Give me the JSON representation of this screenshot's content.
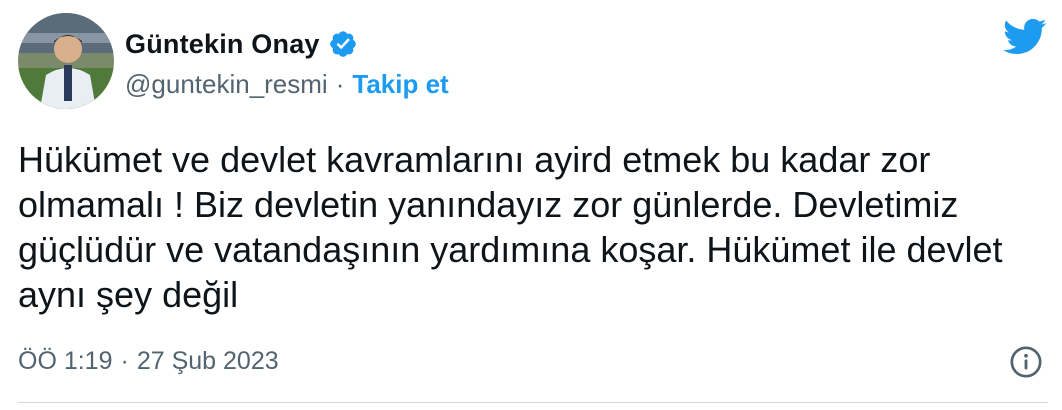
{
  "author": {
    "display_name": "Güntekin Onay",
    "handle": "@guntekin_resmi",
    "separator": "·",
    "follow_label": "Takip et",
    "verified": true
  },
  "tweet": {
    "text": "Hükümet ve devlet kavramlarını ayird etmek bu kadar zor olmamalı ! Biz devletin yanındayız zor günlerde. Devletimiz güçlüdür ve vatandaşının yardımına koşar. Hükümet ile devlet aynı şey değil",
    "time": "ÖÖ 1:19",
    "separator": "·",
    "date": "27 Şub 2023"
  },
  "icons": {
    "brand": "twitter-bird-icon",
    "verified": "verified-badge-icon",
    "info": "info-icon"
  },
  "colors": {
    "accent": "#1d9bf0",
    "text": "#0f1419",
    "secondary": "#536471",
    "divider": "#cfd9de"
  }
}
